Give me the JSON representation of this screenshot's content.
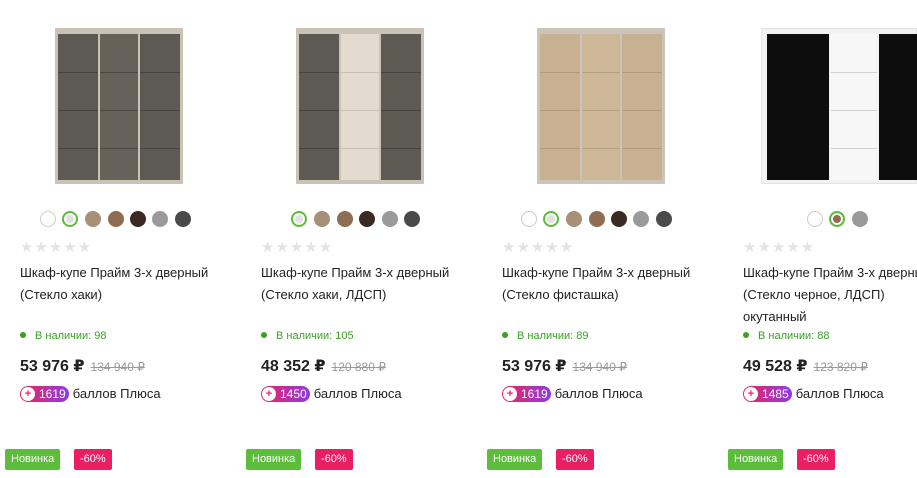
{
  "products": [
    {
      "title": "Шкаф-купе Прайм 3-х дверный (Стекло хаки)",
      "stars": "★★★★★",
      "stock": "В наличии: 98",
      "price": "53 976 ₽",
      "old_price": "134 940 ₽",
      "points": "1619",
      "points_label": "баллов Плюса",
      "badge_new": "Новинка",
      "badge_discount": "-60%"
    },
    {
      "title": "Шкаф-купе Прайм 3-х дверный (Стекло хаки, ЛДСП)",
      "stars": "★★★★★",
      "stock": "В наличии: 105",
      "price": "48 352 ₽",
      "old_price": "120 880 ₽",
      "points": "1450",
      "points_label": "баллов Плюса",
      "badge_new": "Новинка",
      "badge_discount": "-60%"
    },
    {
      "title": "Шкаф-купе Прайм 3-х дверный (Стекло фисташка)",
      "stars": "★★★★★",
      "stock": "В наличии: 89",
      "price": "53 976 ₽",
      "old_price": "134 940 ₽",
      "points": "1619",
      "points_label": "баллов Плюса",
      "badge_new": "Новинка",
      "badge_discount": "-60%"
    },
    {
      "title": "Шкаф-купе Прайм 3-х дверный (Стекло черное, ЛДСП) окутанный",
      "stars": "★★★★★",
      "stock": "В наличии: 88",
      "price": "49 528 ₽",
      "old_price": "123 820 ₽",
      "points": "1485",
      "points_label": "баллов Плюса",
      "badge_new": "Новинка",
      "badge_discount": "-60%"
    }
  ],
  "colors": {
    "stock_green": "#3a9f25",
    "new_badge": "#5bbd3a",
    "discount_badge": "#e91e63",
    "plus_gradient_start": "#f0245a",
    "plus_gradient_end": "#8c3be8",
    "selected_swatch_ring": "#5bbd3a"
  },
  "icons": [
    "plus-points-icon",
    "stock-dot-icon",
    "color-swatch"
  ]
}
